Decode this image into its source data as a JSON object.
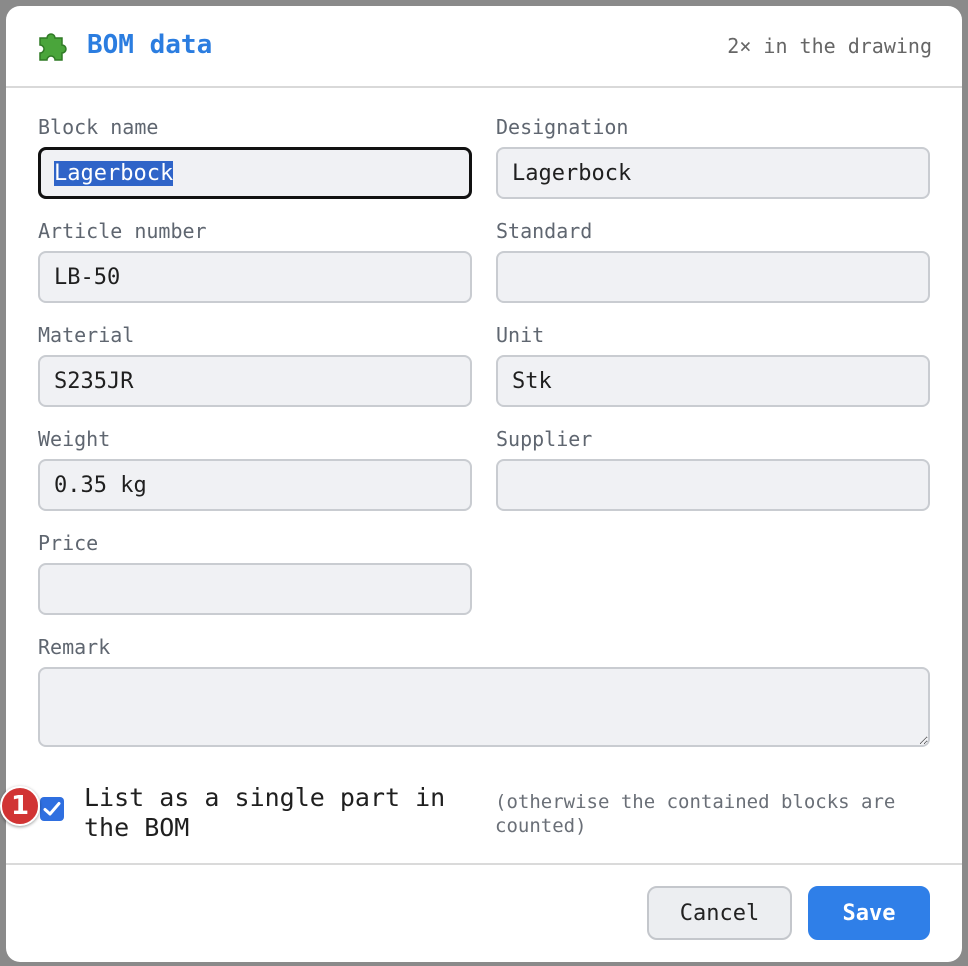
{
  "dialog": {
    "title": "BOM data",
    "title_icon": "puzzle-piece-icon",
    "usage_count": "2× in the drawing"
  },
  "fields": {
    "block_name": {
      "label": "Block name",
      "value": "Lagerbock",
      "focused": true,
      "selected": true
    },
    "designation": {
      "label": "Designation",
      "value": "Lagerbock"
    },
    "article_number": {
      "label": "Article number",
      "value": "LB-50"
    },
    "standard": {
      "label": "Standard",
      "value": ""
    },
    "material": {
      "label": "Material",
      "value": "S235JR"
    },
    "unit": {
      "label": "Unit",
      "value": "Stk"
    },
    "weight": {
      "label": "Weight",
      "value": "0.35 kg"
    },
    "supplier": {
      "label": "Supplier",
      "value": ""
    },
    "price": {
      "label": "Price",
      "value": ""
    },
    "remark": {
      "label": "Remark",
      "value": ""
    }
  },
  "single_part": {
    "label": "List as a single part in the BOM",
    "hint": "(otherwise the contained blocks are counted)",
    "checked": true,
    "badge": "1"
  },
  "buttons": {
    "cancel": "Cancel",
    "save": "Save"
  },
  "colors": {
    "accent": "#2b7de0",
    "save_button": "#2f7fe8",
    "badge": "#d13434",
    "puzzle_icon": "#4aa53b"
  }
}
